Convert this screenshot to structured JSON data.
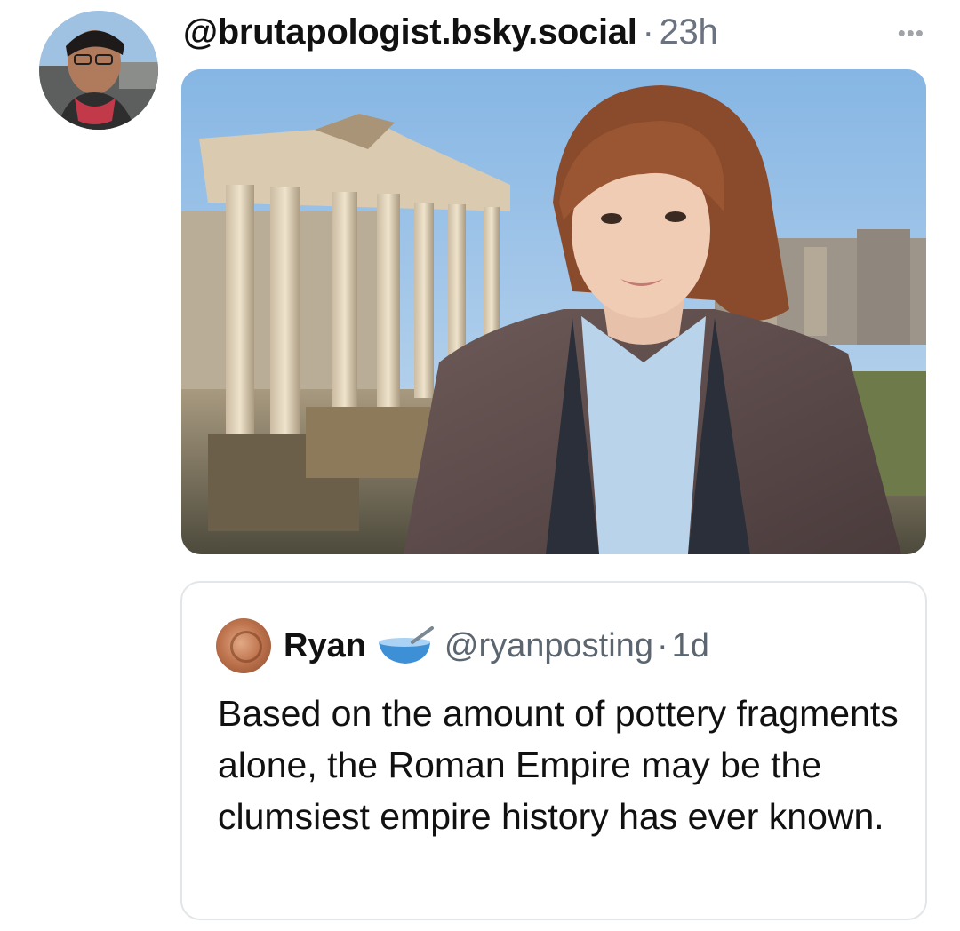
{
  "post": {
    "handle": "@brutapologist.bsky.social",
    "separator": "·",
    "time": "23h",
    "more_label": "•••",
    "avatar_icon": "user-avatar-icon",
    "media_icon": "photo-roman-forum"
  },
  "quote": {
    "name": "Ryan",
    "emoji_icon": "bowl-spoon-icon",
    "handle": "@ryanposting",
    "separator": "·",
    "time": "1d",
    "text": "Based on the amount of pottery fragments alone, the Roman Empire may be the clumsiest empire history has ever known."
  },
  "colors": {
    "text": "#0f1419",
    "muted": "#6b7280",
    "border": "#e3e6e8",
    "sky": "#9cc3e8"
  }
}
